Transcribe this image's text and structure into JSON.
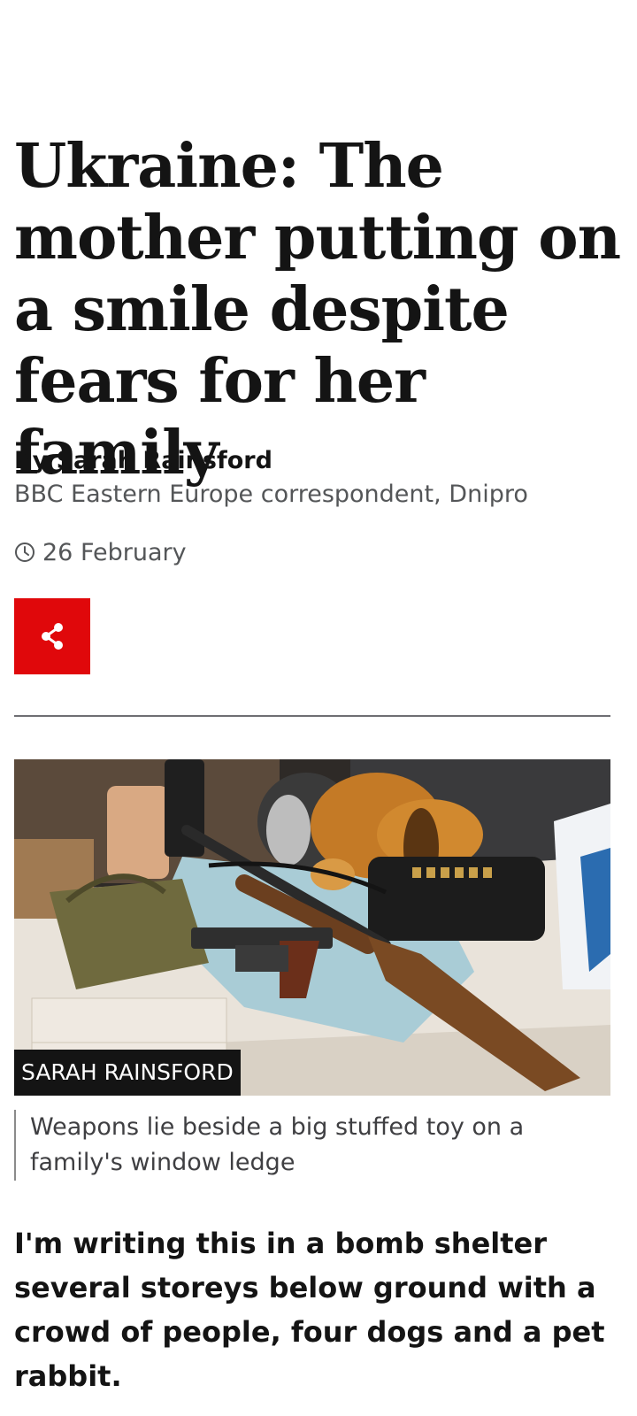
{
  "article": {
    "headline": "Ukraine: The mother putting on a smile despite fears for her family",
    "byline": {
      "author": "By Sarah Rainsford",
      "role": "BBC Eastern Europe correspondent, Dnipro"
    },
    "date": "26 February",
    "share_icon": "share-icon",
    "image": {
      "credit": "SARAH RAINSFORD",
      "caption": "Weapons lie beside a big stuffed toy on a family's window ledge"
    },
    "lead": "I'm writing this in a bomb shelter several storeys below ground with a crowd of people, four dogs and a pet rabbit."
  },
  "colors": {
    "share_button": "#e0080b",
    "text": "#141414",
    "secondary_text": "#545658"
  }
}
